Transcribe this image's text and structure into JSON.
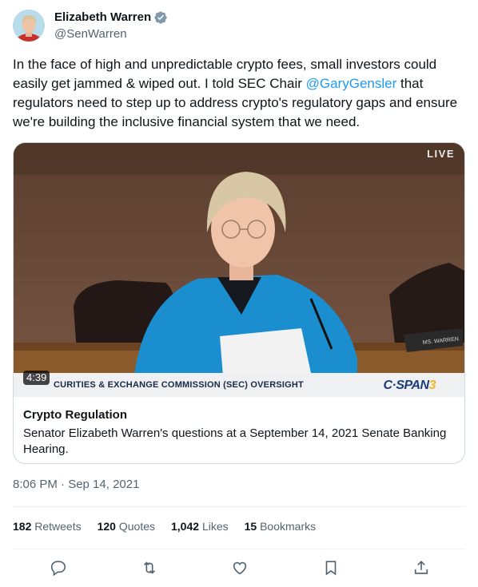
{
  "author": {
    "display_name": "Elizabeth Warren",
    "handle": "@SenWarren",
    "verified": true
  },
  "tweet": {
    "text_before": "In the face of high and unpredictable crypto fees, small investors could easily get jammed & wiped out. I told SEC Chair ",
    "mention": "@GaryGensler",
    "text_after": " that regulators need to step up to address crypto's regulatory gaps and ensure we're building the inclusive financial system that we need."
  },
  "media": {
    "live_badge": "LIVE",
    "duration": "4:39",
    "lower_third": "CURITIES & EXCHANGE COMMISSION (SEC) OVERSIGHT",
    "network": "C·SPAN",
    "network_number": "3",
    "nameplate": "MS. WARREN",
    "card_title": "Crypto Regulation",
    "card_description": "Senator Elizabeth Warren's questions at a September 14, 2021 Senate Banking Hearing."
  },
  "timestamp": "8:06 PM · Sep 14, 2021",
  "stats": [
    {
      "count": "182",
      "label": "Retweets"
    },
    {
      "count": "120",
      "label": "Quotes"
    },
    {
      "count": "1,042",
      "label": "Likes"
    },
    {
      "count": "15",
      "label": "Bookmarks"
    }
  ],
  "actions": [
    "reply-icon",
    "retweet-icon",
    "like-icon",
    "bookmark-icon",
    "share-icon"
  ],
  "colors": {
    "accent": "#1d9bf0",
    "secondary_text": "#536471",
    "border": "#cfd9de"
  }
}
